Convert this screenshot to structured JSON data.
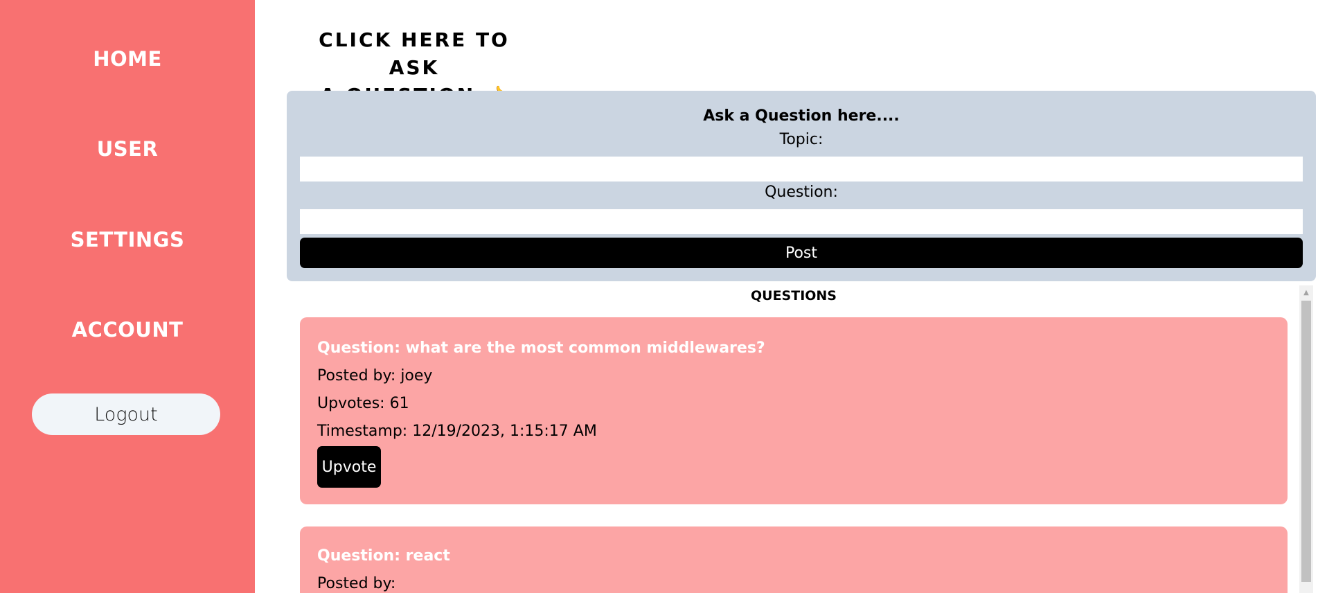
{
  "sidebar": {
    "items": [
      {
        "label": "HOME"
      },
      {
        "label": "USER"
      },
      {
        "label": "SETTINGS"
      },
      {
        "label": "ACCOUNT"
      }
    ],
    "logout_label": "Logout",
    "color": "#f87171"
  },
  "header": {
    "line1": "CLICK HERE TO ASK",
    "line2": "A QUESTION",
    "icon": "pointing-hand-icon",
    "icon_glyph": "👈"
  },
  "ask_form": {
    "title": "Ask a Question here....",
    "topic_label": "Topic:",
    "topic_value": "",
    "question_label": "Question:",
    "question_value": "",
    "post_label": "Post"
  },
  "questions": {
    "heading": "QUESTIONS",
    "items": [
      {
        "title": "Question: what are the most common middlewares?",
        "posted_by": "Posted by: joey",
        "upvotes": "Upvotes: 61",
        "timestamp": "Timestamp: 12/19/2023, 1:15:17 AM",
        "upvote_label": "Upvote"
      },
      {
        "title": "Question: react",
        "posted_by": "Posted by:"
      }
    ]
  },
  "colors": {
    "card": "#fca5a5",
    "form_bg": "#cbd5e1",
    "button": "#000000"
  }
}
